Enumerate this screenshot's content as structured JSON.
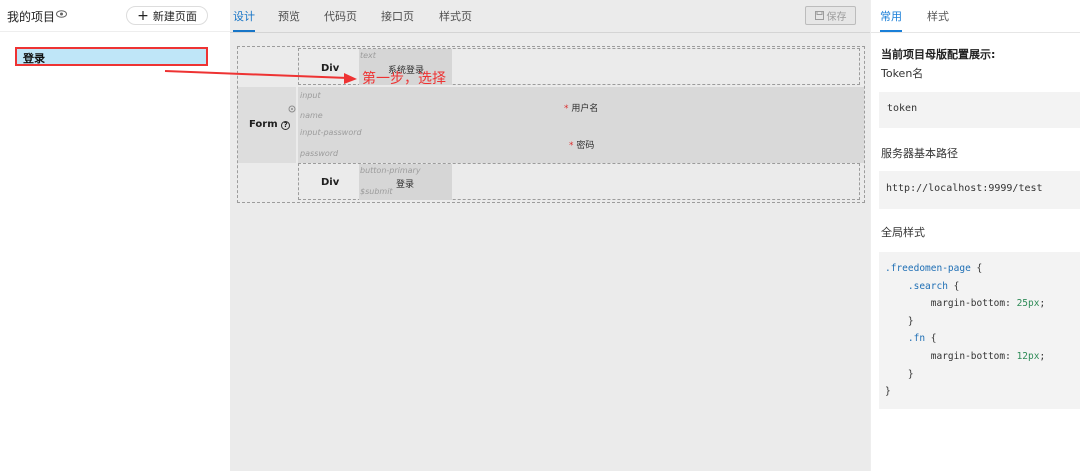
{
  "sidebar": {
    "title": "我的项目",
    "new_page_label": "新建页面",
    "pages": [
      {
        "label": "登录"
      }
    ]
  },
  "tabs": [
    {
      "label": "设计",
      "active": true
    },
    {
      "label": "预览"
    },
    {
      "label": "代码页"
    },
    {
      "label": "接口页"
    },
    {
      "label": "样式页"
    }
  ],
  "toolbar": {
    "save_label": "保存"
  },
  "canvas": {
    "div1": {
      "label": "Div",
      "ghost": "text",
      "text": "系统登录"
    },
    "form": {
      "label": "Form",
      "ghost_input": "input",
      "ghost_name": "name",
      "ghost_input_password": "input-password",
      "ghost_password": "password",
      "username_label": "用户名",
      "password_label": "密码",
      "required_mark": "*"
    },
    "div2": {
      "label": "Div",
      "ghost1": "button-primary",
      "ghost2": "$submit",
      "text": "登录"
    }
  },
  "annotation": {
    "text": "第一步，选择",
    "color": "#e33333"
  },
  "right_panel": {
    "tabs": [
      {
        "label": "常用",
        "active": true
      },
      {
        "label": "样式"
      }
    ],
    "heading": "当前项目母版配置展示:",
    "token_label": "Token名",
    "token_value": "token",
    "base_path_label": "服务器基本路径",
    "base_path_value": "http://localhost:9999/test",
    "global_style_label": "全局样式",
    "code": {
      "l1_sel": ".freedomen-page",
      "l2_sel": ".search",
      "l3_prop": "margin-bottom",
      "l3_val": "25px",
      "l5_sel": ".fn",
      "l6_prop": "margin-bottom",
      "l6_val": "12px"
    }
  },
  "colors": {
    "accent": "#1a7fd8",
    "selected_bg": "#bfe6f8",
    "highlight_border": "#e33333"
  }
}
